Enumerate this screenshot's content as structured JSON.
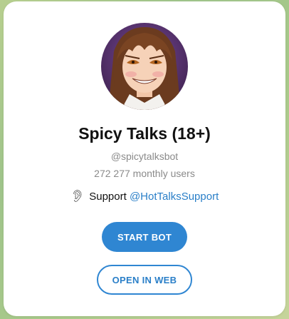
{
  "bot": {
    "title": "Spicy Talks (18+)",
    "username": "@spicytalksbot",
    "monthly_users": "272 277 monthly users",
    "support_label": "Support",
    "support_link": "@HotTalksSupport"
  },
  "buttons": {
    "start_bot": "START BOT",
    "open_in_web": "OPEN IN WEB"
  },
  "icons": {
    "support": "ear-icon",
    "avatar": "anime-girl-avatar"
  },
  "colors": {
    "accent": "#2f86d2",
    "link": "#2a7fc8",
    "muted_text": "#8a8a8a"
  }
}
